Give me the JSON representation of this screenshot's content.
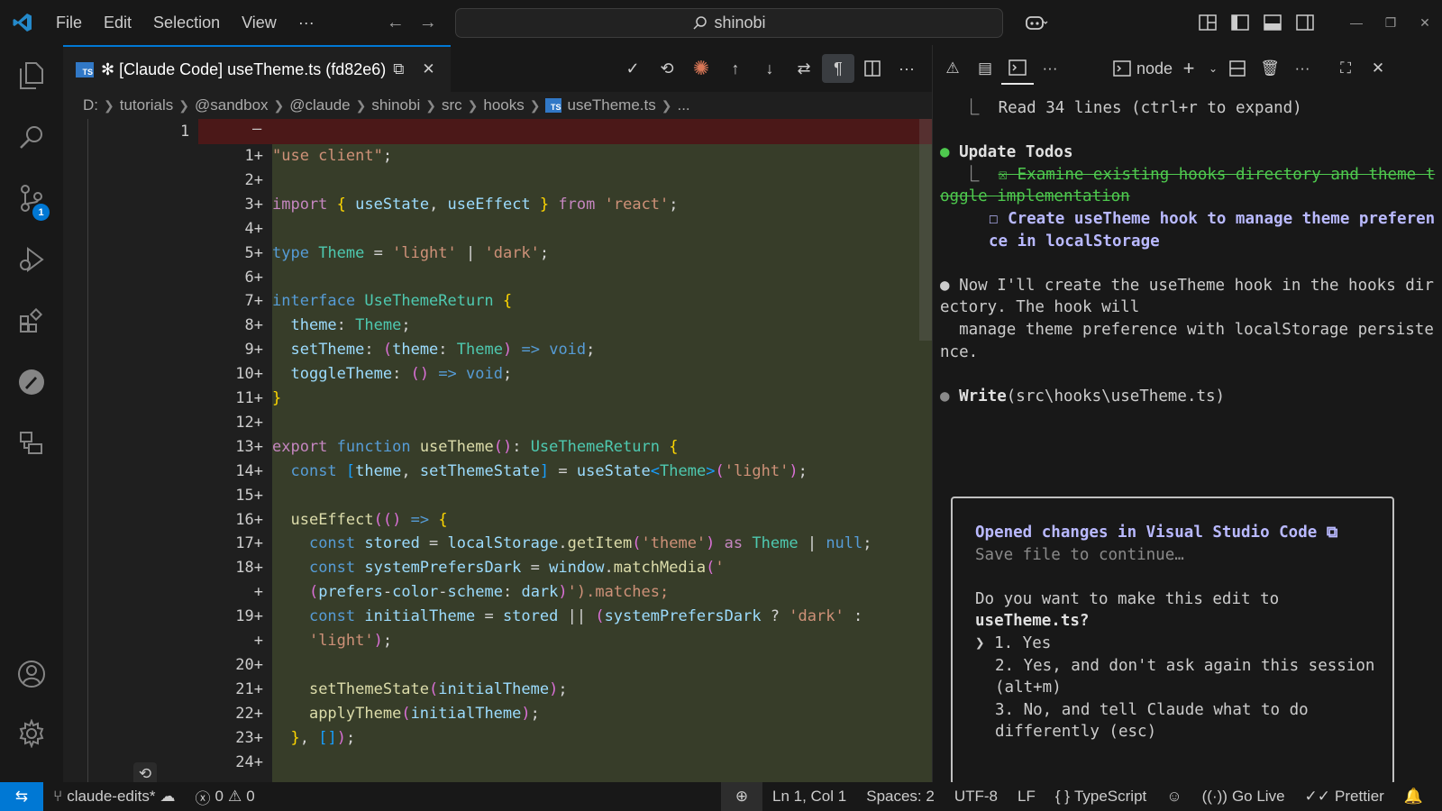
{
  "titlebar": {
    "menu": [
      "File",
      "Edit",
      "Selection",
      "View",
      "···"
    ],
    "search_text": "shinobi"
  },
  "activity": {
    "source_control_badge": "1"
  },
  "tab": {
    "title": "✻ [Claude Code] useTheme.ts (fd82e6)",
    "file_type_badge": "TS"
  },
  "breadcrumb": [
    "D:",
    "tutorials",
    "@sandbox",
    "@claude",
    "shinobi",
    "src",
    "hooks",
    "useTheme.ts",
    "..."
  ],
  "editor": {
    "original_line_number": "1",
    "original_marker": "—",
    "lines": [
      {
        "n": "1+",
        "t": "\"use client\";"
      },
      {
        "n": "2+",
        "t": ""
      },
      {
        "n": "3+",
        "t": "import { useState, useEffect } from 'react';"
      },
      {
        "n": "4+",
        "t": ""
      },
      {
        "n": "5+",
        "t": "type Theme = 'light' | 'dark';"
      },
      {
        "n": "6+",
        "t": ""
      },
      {
        "n": "7+",
        "t": "interface UseThemeReturn {"
      },
      {
        "n": "8+",
        "t": "  theme: Theme;"
      },
      {
        "n": "9+",
        "t": "  setTheme: (theme: Theme) => void;"
      },
      {
        "n": "10+",
        "t": "  toggleTheme: () => void;"
      },
      {
        "n": "11+",
        "t": "}"
      },
      {
        "n": "12+",
        "t": ""
      },
      {
        "n": "13+",
        "t": "export function useTheme(): UseThemeReturn {"
      },
      {
        "n": "14+",
        "t": "  const [theme, setThemeState] = useState<Theme>('light');"
      },
      {
        "n": "15+",
        "t": ""
      },
      {
        "n": "16+",
        "t": "  useEffect(() => {"
      },
      {
        "n": "17+",
        "t": "    const stored = localStorage.getItem('theme') as Theme | null;"
      },
      {
        "n": "18+",
        "t": "    const systemPrefersDark = window.matchMedia('"
      },
      {
        "n": "+",
        "t": "    (prefers-color-scheme: dark)').matches;"
      },
      {
        "n": "19+",
        "t": "    const initialTheme = stored || (systemPrefersDark ? 'dark' :"
      },
      {
        "n": "+",
        "t": "    'light');"
      },
      {
        "n": "20+",
        "t": ""
      },
      {
        "n": "21+",
        "t": "    setThemeState(initialTheme);"
      },
      {
        "n": "22+",
        "t": "    applyTheme(initialTheme);"
      },
      {
        "n": "23+",
        "t": "  }, []);"
      },
      {
        "n": "24+",
        "t": ""
      }
    ]
  },
  "panel": {
    "terminal_name": "node",
    "read_line": "⎿  Read 34 lines (ctrl+r to expand)",
    "todos_title": "Update Todos",
    "todo_done": "☒ Examine existing hooks directory and theme toggle implementation",
    "todo_pending": "☐ Create useTheme hook to manage theme preference in localStorage",
    "message": "Now I'll create the useTheme hook in the hooks directory. The hook will\n  manage theme preference with localStorage persistence.",
    "write_call_fn": "Write",
    "write_call_arg": "(src\\hooks\\useTheme.ts)",
    "dialog": {
      "title": "Opened changes in Visual Studio Code ⧉",
      "subtitle": "Save file to continue…",
      "question_line1": "Do you want to make this edit to",
      "question_file": "useTheme.ts?",
      "options": [
        "❯ 1. Yes",
        "2. Yes, and don't ask again this session (alt+m)",
        "3. No, and tell Claude what to do differently (esc)"
      ]
    }
  },
  "statusbar": {
    "branch": "claude-edits*",
    "errors": "0",
    "warnings": "0",
    "position": "Ln 1, Col 1",
    "spaces": "Spaces: 2",
    "encoding": "UTF-8",
    "eol": "LF",
    "language": "TypeScript",
    "golive": "Go Live",
    "prettier": "Prettier"
  },
  "colors": {
    "accent": "#0078d4",
    "added_bg": "#373d29",
    "deleted_bg": "#4b1818",
    "todo_green": "#4ec94e",
    "dialog_title": "#b9b9ff"
  }
}
